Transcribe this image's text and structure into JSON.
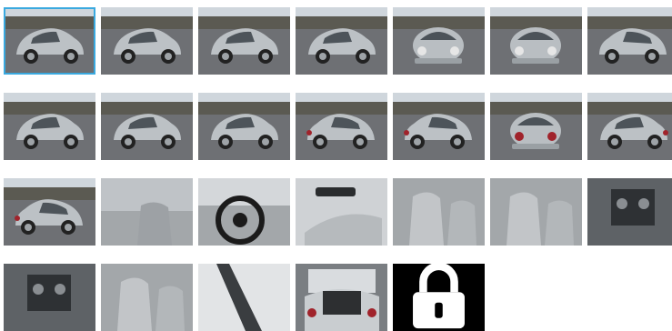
{
  "gallery": {
    "selected_index": 0,
    "colors": {
      "selected_border": "#3aa9df",
      "locked_bg": "#000000"
    },
    "thumbnails": [
      {
        "view": "front-left-exterior"
      },
      {
        "view": "front-left-exterior"
      },
      {
        "view": "left-side-exterior"
      },
      {
        "view": "left-side-exterior"
      },
      {
        "view": "front-exterior"
      },
      {
        "view": "front-exterior"
      },
      {
        "view": "front-right-exterior"
      },
      {
        "view": "front-left-exterior"
      },
      {
        "view": "left-side-exterior"
      },
      {
        "view": "left-side-exterior"
      },
      {
        "view": "rear-left-exterior"
      },
      {
        "view": "rear-left-exterior"
      },
      {
        "view": "rear-exterior"
      },
      {
        "view": "rear-right-exterior"
      },
      {
        "view": "rear-left-exterior"
      },
      {
        "view": "interior-front-door-open"
      },
      {
        "view": "interior-dashboard-steering-wheel"
      },
      {
        "view": "interior-door-panel"
      },
      {
        "view": "interior-front-seats"
      },
      {
        "view": "interior-seats"
      },
      {
        "view": "interior-center-console"
      },
      {
        "view": "interior-center-stack-controls"
      },
      {
        "view": "interior-passenger-seat"
      },
      {
        "view": "interior-windshield-pillar"
      },
      {
        "view": "rear-trunk-open"
      }
    ],
    "locked_tile": {
      "icon": "lock-icon"
    }
  }
}
